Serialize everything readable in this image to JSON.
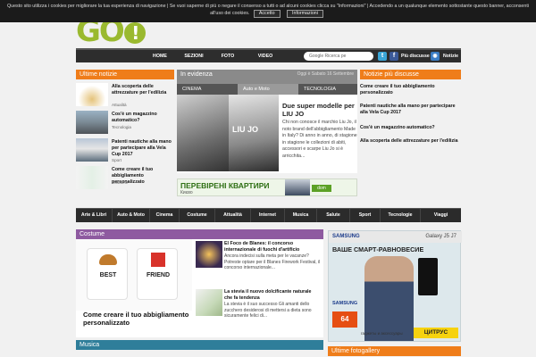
{
  "cookie_bar": {
    "text_line1": "Questo sito utilizza i cookies per migliorare la tua esperienza di navigazione | Se vuoi saperne di più o negare il consenso a tutti o ad alcuni cookies clicca su \"Informazioni\" | Accedendo a un qualunque elemento sottostante questo banner, acconsenti",
    "text_line2": "all'uso dei cookies.",
    "accept_label": "Accetto",
    "info_label": "Informazioni"
  },
  "logo": {
    "text": "GO"
  },
  "nav": {
    "items": [
      "HOME",
      "SEZIONI",
      "FOTO",
      "VIDEO"
    ],
    "search_placeholder": "Google Ricerca pe",
    "most_discussed": "Più discusse",
    "news": "Notizie"
  },
  "ultime_notizie": {
    "title": "Ultime notizie",
    "items": [
      {
        "title": "Alla scoperta delle attrezzature per l'edilizia",
        "category": "Attualità"
      },
      {
        "title": "Cos'è un magazzino automatico?",
        "category": "Tecnologia"
      },
      {
        "title": "Patenti nautiche alla mano per partecipare alla Vela Cup 2017",
        "category": "Sport"
      },
      {
        "title": "Come creare il tuo abbigliamento personalizzato",
        "category": "Costume"
      }
    ]
  },
  "in_evidenza": {
    "title": "In evidenza",
    "date": "Oggi è Sabato 16 Settembre",
    "tabs": [
      "CINEMA",
      "Auto e Moto",
      "TECNOLOGIA"
    ],
    "image_label": "LIU JO",
    "headline": "Due super modelle per LIU JO",
    "text": "Chi non conosce il marchio Liu Jo, il noto brand dell'abbigliamento Made in Italy? Di anno in anno, di stagione in stagione le collezioni di abiti, accessori e scarpe Liu Jo si è arricchita..."
  },
  "most_discussed": {
    "title": "Notizie più discusse",
    "items": [
      "Come creare il tuo abbigliamento personalizzato",
      "Patenti nautiche alla mano per partecipare alla Vela Cup 2017",
      "Cos'è un magazzino automatico?",
      "Alla scoperta delle attrezzature per l'edilizia"
    ]
  },
  "banner_ad": {
    "headline": "ПЕРЕВІРЕНІ КВАРТИРИ",
    "city": "Києво",
    "brand": "dom"
  },
  "categories": [
    "Arte & Libri",
    "Auto & Moto",
    "Cinema",
    "Costume",
    "Attualità",
    "Internet",
    "Musica",
    "Salute",
    "Sport",
    "Tecnologie",
    "Viaggi"
  ],
  "costume": {
    "title": "Costume",
    "shirt_labels": [
      "BEST",
      "FRIEND"
    ],
    "main_title": "Come creare il tuo abbigliamento personalizzato",
    "items": [
      {
        "title": "El Foco de Blanes: il concorso internazionale di fuochi d'artificio",
        "text": "Ancora indecisi sulla meta per le vacanze? Potreste optare per il Blanes Firework Festival, il concorso internazionale..."
      },
      {
        "title": "La stevia il nuovo dolcificante naturale che fa tendenza",
        "text": "La stevia è il suo successo Gli amanti dello zucchero desiderosi di mettersi a dieta sono sicuramente felici di..."
      }
    ]
  },
  "musica": {
    "title": "Musica"
  },
  "side_ad": {
    "brand": "SAMSUNG",
    "model": "Galaxy J5 J7",
    "headline": "ВАШЕ СМАРТ-РАВНОВЕСИЕ",
    "price": "64",
    "store": "ЦИТРУС",
    "store_tagline": "гаджеты и аксессуары"
  },
  "ultime_foto": {
    "title": "Ultime fotogallery"
  },
  "colors": {
    "orange": "#ef7d1a",
    "purple": "#8e5aa0",
    "teal": "#2f7e9a",
    "dark": "#2d2d2d"
  }
}
